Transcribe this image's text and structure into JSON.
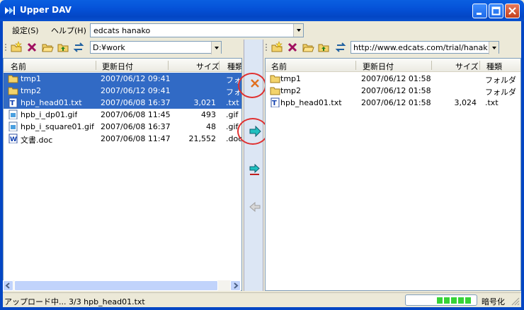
{
  "window": {
    "title": "Upper DAV"
  },
  "menu": {
    "settings": "設定(S)",
    "help": "ヘルプ(H)"
  },
  "user": {
    "name": "edcats hanako"
  },
  "left": {
    "path": "D:¥work",
    "columns": [
      "名前",
      "更新日付",
      "サイズ",
      "種類"
    ],
    "rows": [
      {
        "name": "tmp1",
        "date": "2007/06/12 09:41",
        "size": "",
        "type": "フォルダ",
        "icon": "folder-icon",
        "selected": true
      },
      {
        "name": "tmp2",
        "date": "2007/06/12 09:41",
        "size": "",
        "type": "フォルダ",
        "icon": "folder-icon",
        "selected": true
      },
      {
        "name": "hpb_head01.txt",
        "date": "2007/06/08 16:37",
        "size": "3,021",
        "type": ".txt",
        "icon": "text-file-icon",
        "selected": true
      },
      {
        "name": "hpb_i_dp01.gif",
        "date": "2007/06/08 11:45",
        "size": "493",
        "type": ".gif",
        "icon": "image-file-icon",
        "selected": false
      },
      {
        "name": "hpb_i_square01.gif",
        "date": "2007/06/08 16:37",
        "size": "48",
        "type": ".gif",
        "icon": "image-file-icon",
        "selected": false
      },
      {
        "name": "文書.doc",
        "date": "2007/06/08 11:47",
        "size": "21,552",
        "type": ".doc",
        "icon": "doc-file-icon",
        "selected": false
      }
    ]
  },
  "right": {
    "path": "http://www.edcats.com/trial/hanako.",
    "columns": [
      "名前",
      "更新日付",
      "サイズ",
      "種類"
    ],
    "rows": [
      {
        "name": "tmp1",
        "date": "2007/06/12 01:58",
        "size": "",
        "type": "フォルダ",
        "icon": "folder-icon"
      },
      {
        "name": "tmp2",
        "date": "2007/06/12 01:58",
        "size": "",
        "type": "フォルダ",
        "icon": "folder-icon"
      },
      {
        "name": "hpb_head01.txt",
        "date": "2007/06/12 01:58",
        "size": "3,024",
        "type": ".txt",
        "icon": "text-file-icon"
      }
    ]
  },
  "status": {
    "text": "アップロード中... 3/3  hpb_head01.txt",
    "encryption": "暗号化",
    "progress_blocks": 5
  },
  "colors": {
    "selection": "#316ac5",
    "titlebar": "#0346c4",
    "highlight_circle": "#e03030"
  }
}
